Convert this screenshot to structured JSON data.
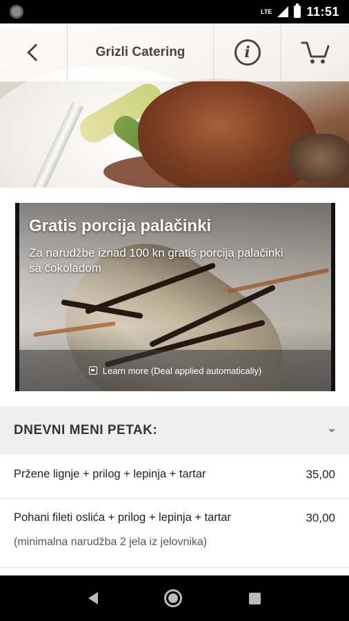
{
  "status_bar": {
    "network": "LTE",
    "time": "11:51"
  },
  "toolbar": {
    "title": "Grizli Catering"
  },
  "promo": {
    "title": "Gratis porcija palačinki",
    "description": "Za narudžbe iznad 100 kn gratis porcija palačinki sa čokoladom",
    "footer": "Learn more (Deal applied automatically)"
  },
  "menu": {
    "section_title": "DNEVNI MENI PETAK:",
    "items": [
      {
        "name": "Pržene lignje + prilog + lepinja + tartar",
        "price": "35,00"
      },
      {
        "name": "Pohani fileti oslića + prilog + lepinja + tartar",
        "price": "30,00",
        "note": "(minimalna narudžba 2 jela iz jelovnika)"
      }
    ]
  },
  "icons": {
    "back": "chevron-left-icon",
    "info": "info-icon",
    "cart": "cart-icon",
    "deal": "tag-icon"
  }
}
